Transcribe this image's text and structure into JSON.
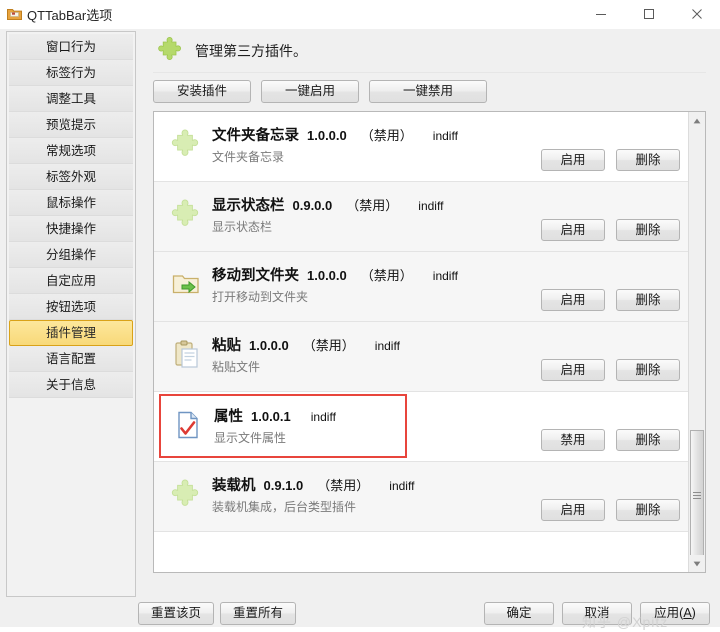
{
  "window": {
    "title": "QTTabBar选项",
    "icon": "folder-icon",
    "minimize_label": "─",
    "maximize_label": "□",
    "close_label": "✕"
  },
  "sidebar": {
    "items": [
      {
        "label": "窗口行为",
        "selected": false
      },
      {
        "label": "标签行为",
        "selected": false
      },
      {
        "label": "调整工具",
        "selected": false
      },
      {
        "label": "预览提示",
        "selected": false
      },
      {
        "label": "常规选项",
        "selected": false
      },
      {
        "label": "标签外观",
        "selected": false
      },
      {
        "label": "鼠标操作",
        "selected": false
      },
      {
        "label": "快捷操作",
        "selected": false
      },
      {
        "label": "分组操作",
        "selected": false
      },
      {
        "label": "自定应用",
        "selected": false
      },
      {
        "label": "按钮选项",
        "selected": false
      },
      {
        "label": "插件管理",
        "selected": true
      },
      {
        "label": "语言配置",
        "selected": false
      },
      {
        "label": "关于信息",
        "selected": false
      }
    ],
    "selected_color": "#f8d979",
    "selected_border_color": "#d9a218"
  },
  "panel": {
    "heading": "管理第三方插件。",
    "heading_icon": "puzzle-piece-icon",
    "toolbar": [
      {
        "label": "安装插件"
      },
      {
        "label": "一键启用"
      },
      {
        "label": "一键禁用"
      }
    ]
  },
  "plugins": [
    {
      "name": "文件夹备忘录",
      "version": "1.0.0.0",
      "state": "（禁用）",
      "author": "indiff",
      "description": "文件夹备忘录",
      "icon": "puzzle-piece-icon",
      "toggle_label": "启用",
      "delete_label": "删除",
      "highlighted": false,
      "row_shade": "white"
    },
    {
      "name": "显示状态栏",
      "version": "0.9.0.0",
      "state": "（禁用）",
      "author": "indiff",
      "description": "显示状态栏",
      "icon": "puzzle-piece-icon",
      "toggle_label": "启用",
      "delete_label": "删除",
      "highlighted": false,
      "row_shade": "grey"
    },
    {
      "name": "移动到文件夹",
      "version": "1.0.0.0",
      "state": "（禁用）",
      "author": "indiff",
      "description": "打开移动到文件夹",
      "icon": "move-to-folder-icon",
      "toggle_label": "启用",
      "delete_label": "删除",
      "highlighted": false,
      "row_shade": "grey"
    },
    {
      "name": "粘贴",
      "version": "1.0.0.0",
      "state": "（禁用）",
      "author": "indiff",
      "description": "粘贴文件",
      "icon": "clipboard-paste-icon",
      "toggle_label": "启用",
      "delete_label": "删除",
      "highlighted": false,
      "row_shade": "grey"
    },
    {
      "name": "属性",
      "version": "1.0.0.1",
      "state": "",
      "author": "indiff",
      "description": "显示文件属性",
      "icon": "file-properties-icon",
      "toggle_label": "禁用",
      "delete_label": "删除",
      "highlighted": true,
      "row_shade": "white"
    },
    {
      "name": "装载机",
      "version": "0.9.1.0",
      "state": "（禁用）",
      "author": "indiff",
      "description": "装载机集成，后台类型插件",
      "icon": "puzzle-piece-icon",
      "toggle_label": "启用",
      "delete_label": "删除",
      "highlighted": false,
      "row_shade": "grey"
    }
  ],
  "highlight_box_color": "#e8453c",
  "scrollbar": {
    "up_arrow": "▲",
    "down_arrow": "▼"
  },
  "footer": {
    "reset_page": "重置该页",
    "reset_all": "重置所有",
    "ok": "确定",
    "cancel": "取消",
    "apply_prefix": "应用(",
    "apply_accel": "A",
    "apply_suffix": ")"
  },
  "watermark": "知乎 @Xpitz"
}
